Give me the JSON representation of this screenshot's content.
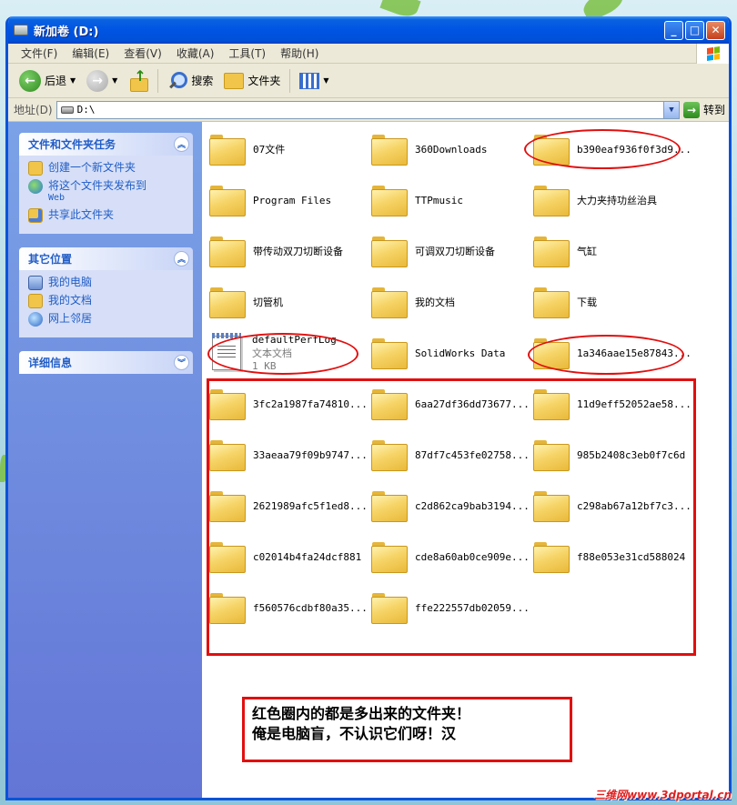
{
  "window": {
    "title": "新加卷 (D:)"
  },
  "menubar": {
    "items": [
      "文件(F)",
      "编辑(E)",
      "查看(V)",
      "收藏(A)",
      "工具(T)",
      "帮助(H)"
    ]
  },
  "toolbar": {
    "back": "后退",
    "search": "搜索",
    "folders": "文件夹"
  },
  "address": {
    "label": "地址(D)",
    "value": "D:\\",
    "go": "转到"
  },
  "taskpane": {
    "file_tasks": {
      "title": "文件和文件夹任务",
      "items": [
        "创建一个新文件夹",
        "将这个文件夹发布到",
        "Web",
        "共享此文件夹"
      ]
    },
    "other_places": {
      "title": "其它位置",
      "items": [
        "我的电脑",
        "我的文档",
        "网上邻居"
      ]
    },
    "details": {
      "title": "详细信息"
    }
  },
  "files": [
    "07文件",
    "360Downloads",
    "b390eaf936f0f3d9...",
    "Program Files",
    "TTPmusic",
    "大力夹持功丝治具",
    "带传动双刀切断设备",
    "可调双刀切断设备",
    "气缸",
    "切管机",
    "我的文档",
    "下载",
    "defaultPerfLog",
    "SolidWorks Data",
    "1a346aae15e87843...",
    "3fc2a1987fa74810...",
    "6aa27df36dd73677...",
    "11d9eff52052ae58...",
    "33aeaa79f09b9747...",
    "87df7c453fe02758...",
    "985b2408c3eb0f7c6d",
    "2621989afc5f1ed8...",
    "c2d862ca9bab3194...",
    "c298ab67a12bf7c3...",
    "c02014b4fa24dcf881",
    "cde8a60ab0ce909e...",
    "f88e053e31cd588024",
    "f560576cdbf80a35...",
    "ffe222557db02059..."
  ],
  "textfile": {
    "type": "文本文档",
    "size": "1 KB"
  },
  "annotation": {
    "line1": "红色圈内的都是多出来的文件夹！",
    "line2": "俺是电脑盲，不认识它们呀！汉"
  },
  "watermark": "三维网www.3dportal.cn",
  "colors": {
    "title_bar": "#0054e3",
    "task_pane": "#6375d6",
    "annotation_red": "#e10f0f"
  }
}
